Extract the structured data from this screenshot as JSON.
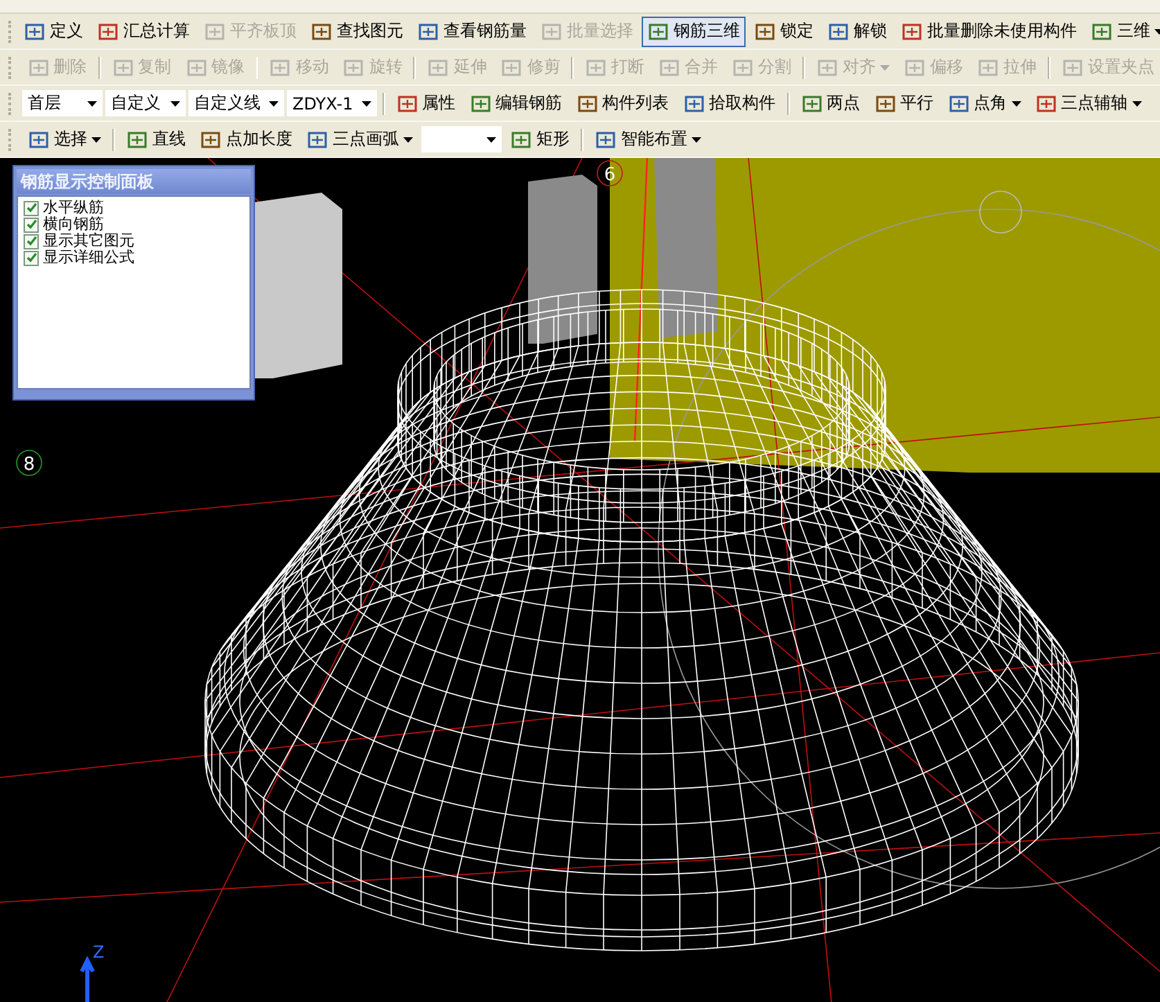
{
  "toolbars": [
    {
      "items": [
        {
          "kind": "button",
          "label": "定义",
          "disabled": false,
          "pressed": false
        },
        {
          "kind": "button",
          "label": "汇总计算",
          "disabled": false,
          "pressed": false
        },
        {
          "kind": "button",
          "label": "平齐板顶",
          "disabled": true,
          "pressed": false
        },
        {
          "kind": "button",
          "label": "查找图元",
          "disabled": false,
          "pressed": false
        },
        {
          "kind": "button",
          "label": "查看钢筋量",
          "disabled": false,
          "pressed": false
        },
        {
          "kind": "button",
          "label": "批量选择",
          "disabled": true,
          "pressed": false
        },
        {
          "kind": "button",
          "label": "钢筋三维",
          "disabled": false,
          "pressed": true
        },
        {
          "kind": "button",
          "label": "锁定",
          "disabled": false,
          "pressed": false
        },
        {
          "kind": "button",
          "label": "解锁",
          "disabled": false,
          "pressed": false
        },
        {
          "kind": "button",
          "label": "批量删除未使用构件",
          "disabled": false,
          "pressed": false
        },
        {
          "kind": "dropdown",
          "label": "三维",
          "disabled": false,
          "pressed": false
        }
      ]
    },
    {
      "items": [
        {
          "kind": "button",
          "label": "删除",
          "disabled": true,
          "pressed": false
        },
        {
          "kind": "separator"
        },
        {
          "kind": "button",
          "label": "复制",
          "disabled": true,
          "pressed": false
        },
        {
          "kind": "button",
          "label": "镜像",
          "disabled": true,
          "pressed": false
        },
        {
          "kind": "separator"
        },
        {
          "kind": "button",
          "label": "移动",
          "disabled": true,
          "pressed": false
        },
        {
          "kind": "button",
          "label": "旋转",
          "disabled": true,
          "pressed": false
        },
        {
          "kind": "separator"
        },
        {
          "kind": "button",
          "label": "延伸",
          "disabled": true,
          "pressed": false
        },
        {
          "kind": "button",
          "label": "修剪",
          "disabled": true,
          "pressed": false
        },
        {
          "kind": "separator"
        },
        {
          "kind": "button",
          "label": "打断",
          "disabled": true,
          "pressed": false
        },
        {
          "kind": "button",
          "label": "合并",
          "disabled": true,
          "pressed": false
        },
        {
          "kind": "button",
          "label": "分割",
          "disabled": true,
          "pressed": false
        },
        {
          "kind": "separator"
        },
        {
          "kind": "dropdown",
          "label": "对齐",
          "disabled": true,
          "pressed": false
        },
        {
          "kind": "button",
          "label": "偏移",
          "disabled": true,
          "pressed": false
        },
        {
          "kind": "button",
          "label": "拉伸",
          "disabled": true,
          "pressed": false
        },
        {
          "kind": "separator"
        },
        {
          "kind": "button",
          "label": "设置夹点",
          "disabled": true,
          "pressed": false
        }
      ]
    },
    {
      "items": [
        {
          "kind": "combo",
          "value": "首层"
        },
        {
          "kind": "combo",
          "value": "自定义"
        },
        {
          "kind": "combo",
          "value": "自定义线"
        },
        {
          "kind": "combo",
          "value": "ZDYX-1"
        },
        {
          "kind": "separator"
        },
        {
          "kind": "button",
          "label": "属性",
          "disabled": false,
          "pressed": false
        },
        {
          "kind": "button",
          "label": "编辑钢筋",
          "disabled": false,
          "pressed": false
        },
        {
          "kind": "button",
          "label": "构件列表",
          "disabled": false,
          "pressed": false
        },
        {
          "kind": "button",
          "label": "拾取构件",
          "disabled": false,
          "pressed": false
        },
        {
          "kind": "separator"
        },
        {
          "kind": "button",
          "label": "两点",
          "disabled": false,
          "pressed": false
        },
        {
          "kind": "button",
          "label": "平行",
          "disabled": false,
          "pressed": false
        },
        {
          "kind": "dropdown",
          "label": "点角",
          "disabled": false,
          "pressed": false
        },
        {
          "kind": "dropdown",
          "label": "三点辅轴",
          "disabled": false,
          "pressed": false
        }
      ]
    },
    {
      "items": [
        {
          "kind": "dropdown",
          "label": "选择",
          "disabled": false,
          "pressed": false
        },
        {
          "kind": "separator"
        },
        {
          "kind": "button",
          "label": "直线",
          "disabled": false,
          "pressed": false
        },
        {
          "kind": "button",
          "label": "点加长度",
          "disabled": false,
          "pressed": false
        },
        {
          "kind": "dropdown",
          "label": "三点画弧",
          "disabled": false,
          "pressed": false
        },
        {
          "kind": "combo",
          "value": ""
        },
        {
          "kind": "button",
          "label": "矩形",
          "disabled": false,
          "pressed": false
        },
        {
          "kind": "separator"
        },
        {
          "kind": "dropdown",
          "label": "智能布置",
          "disabled": false,
          "pressed": false
        }
      ]
    }
  ],
  "panel": {
    "title": "钢筋显示控制面板",
    "options": [
      {
        "label": "水平纵筋",
        "checked": true
      },
      {
        "label": "横向钢筋",
        "checked": true
      },
      {
        "label": "显示其它图元",
        "checked": true
      },
      {
        "label": "显示详细公式",
        "checked": true
      }
    ]
  },
  "viewport": {
    "axis_labels": [
      "8",
      "6"
    ],
    "z_axis_label": "Z"
  }
}
